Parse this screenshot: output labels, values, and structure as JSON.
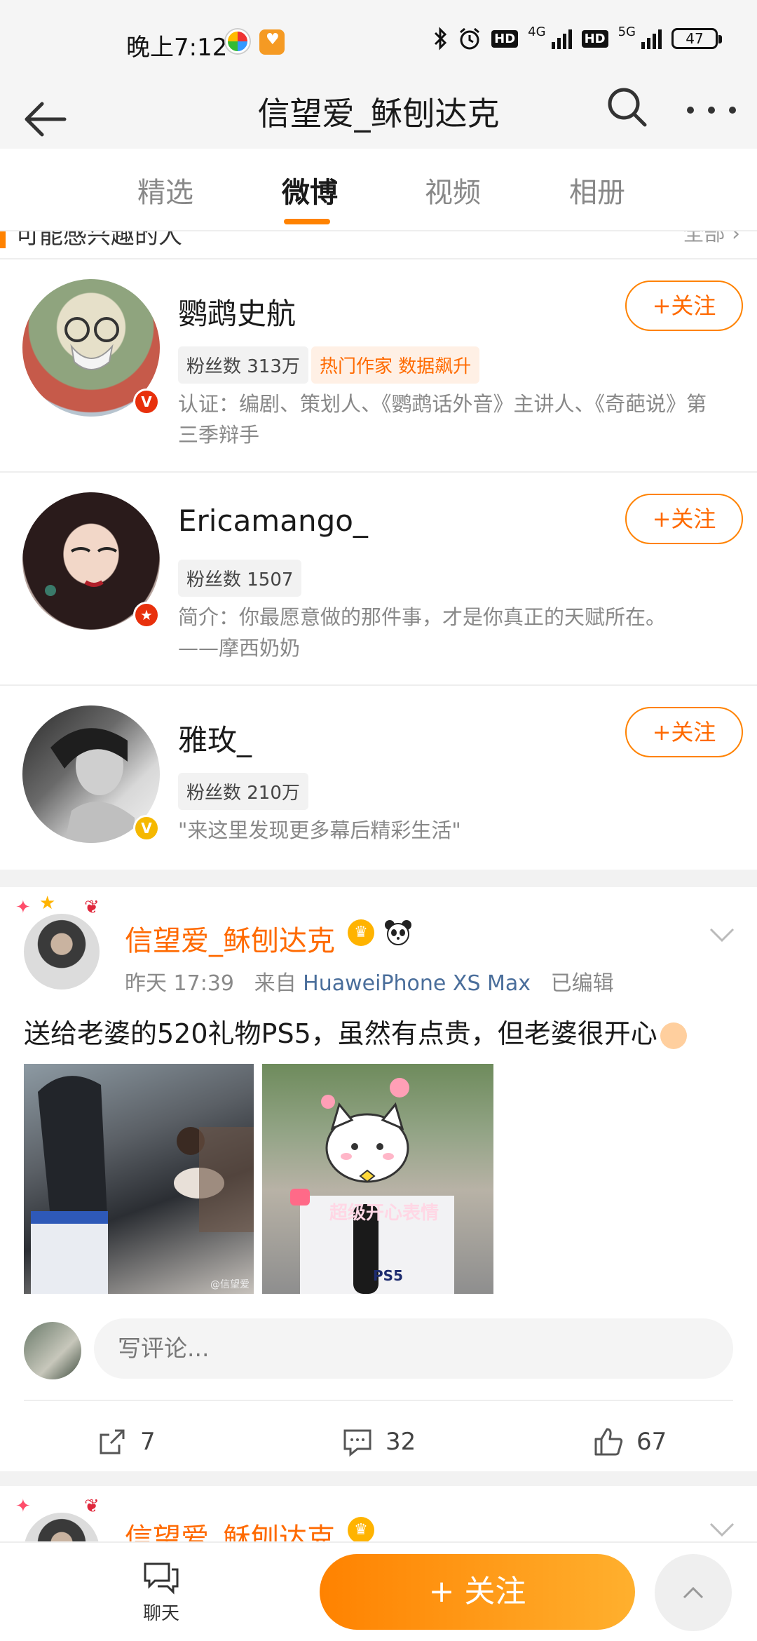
{
  "status_bar": {
    "time": "晚上7:12",
    "net1": "4G",
    "net2": "5G",
    "hd": "HD",
    "battery": "47"
  },
  "nav": {
    "title": "信望爱_稣刨达克"
  },
  "tabs": [
    {
      "label": "精选"
    },
    {
      "label": "微博"
    },
    {
      "label": "视频"
    },
    {
      "label": "相册"
    }
  ],
  "active_tab_index": 1,
  "recommend": {
    "header_partial": "可能感兴趣的人",
    "header_right_partial": "全部 ›",
    "people": [
      {
        "name": "鹦鹉史航",
        "fans": "粉丝数 313万",
        "tag": "热门作家 数据飙升",
        "desc_line1": "认证：编剧、策划人、《鹦鹉话外音》主讲人、《奇葩说》第",
        "desc_line2": "三季辩手",
        "follow_label": "+关注",
        "badge": "V",
        "badge_color": "#e8300c"
      },
      {
        "name": "Ericamango_",
        "fans": "粉丝数 1507",
        "tag": "",
        "desc_line1": "简介：你最愿意做的那件事，才是你真正的天赋所在。",
        "desc_line2": "——摩西奶奶",
        "follow_label": "+关注",
        "badge": "★",
        "badge_color": "#e8300c"
      },
      {
        "name": "雅玫_",
        "fans": "粉丝数 210万",
        "tag": "",
        "desc_line1": "\"来这里发现更多幕后精彩生活\"",
        "desc_line2": "",
        "follow_label": "+关注",
        "badge": "V",
        "badge_color": "#f5b800"
      }
    ]
  },
  "post": {
    "author": "信望爱_稣刨达克",
    "time": "昨天 17:39",
    "from_prefix": "来自",
    "source": "HuaweiPhone XS Max",
    "edited": "已编辑",
    "text": "送给老婆的520礼物PS5，虽然有点贵，但老婆很开心",
    "image2_caption": "超级开心表情",
    "image2_ps5": "PS5",
    "image1_watermark": "@信望爱",
    "comment_placeholder": "写评论...",
    "reposts": "7",
    "comments": "32",
    "likes": "67"
  },
  "post2": {
    "author": "信望爱_稣刨达克"
  },
  "bottom_bar": {
    "chat_label": "聊天",
    "follow_label": "+ 关注"
  },
  "colors": {
    "accent": "#ff8200",
    "link": "#4a6e9b"
  }
}
